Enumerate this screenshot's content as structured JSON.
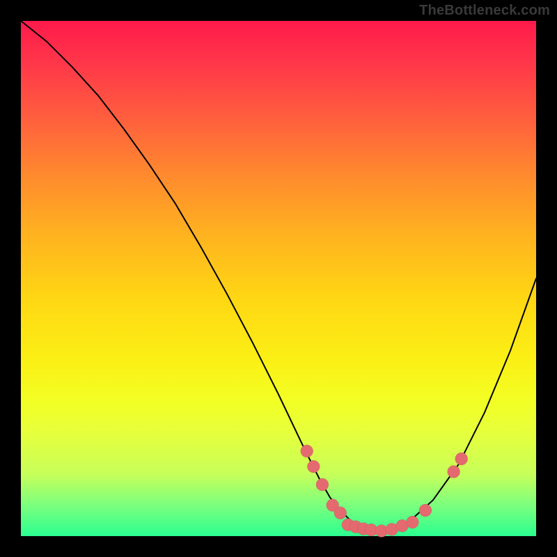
{
  "attribution": "TheBottleneck.com",
  "colors": {
    "point_fill": "#e46a6f",
    "curve_stroke": "#000000"
  },
  "chart_data": {
    "type": "line",
    "title": "",
    "xlabel": "",
    "ylabel": "",
    "xlim": [
      0,
      100
    ],
    "ylim": [
      0,
      100
    ],
    "grid": false,
    "legend": false,
    "curve": {
      "x": [
        0,
        5,
        10,
        15,
        20,
        25,
        30,
        35,
        40,
        45,
        50,
        55,
        58,
        60,
        62,
        64,
        66,
        68,
        70,
        72,
        75,
        80,
        85,
        90,
        95,
        100
      ],
      "y": [
        100,
        96,
        91,
        85.5,
        79,
        72,
        64.5,
        56,
        47,
        37.5,
        27.5,
        17,
        11,
        7.5,
        5,
        3,
        1.8,
        1.2,
        1,
        1.3,
        2.5,
        7,
        14,
        24,
        36,
        50
      ]
    },
    "points": [
      {
        "x": 55.5,
        "y": 16.5
      },
      {
        "x": 56.8,
        "y": 13.5
      },
      {
        "x": 58.5,
        "y": 10.0
      },
      {
        "x": 60.5,
        "y": 6.0
      },
      {
        "x": 62.0,
        "y": 4.5
      },
      {
        "x": 63.5,
        "y": 2.2
      },
      {
        "x": 65.0,
        "y": 1.8
      },
      {
        "x": 66.5,
        "y": 1.4
      },
      {
        "x": 68.0,
        "y": 1.2
      },
      {
        "x": 70.0,
        "y": 1.0
      },
      {
        "x": 72.0,
        "y": 1.3
      },
      {
        "x": 74.0,
        "y": 2.0
      },
      {
        "x": 76.0,
        "y": 2.7
      },
      {
        "x": 78.5,
        "y": 5.0
      },
      {
        "x": 84.0,
        "y": 12.5
      },
      {
        "x": 85.5,
        "y": 15.0
      }
    ],
    "point_radius_px": 9
  }
}
